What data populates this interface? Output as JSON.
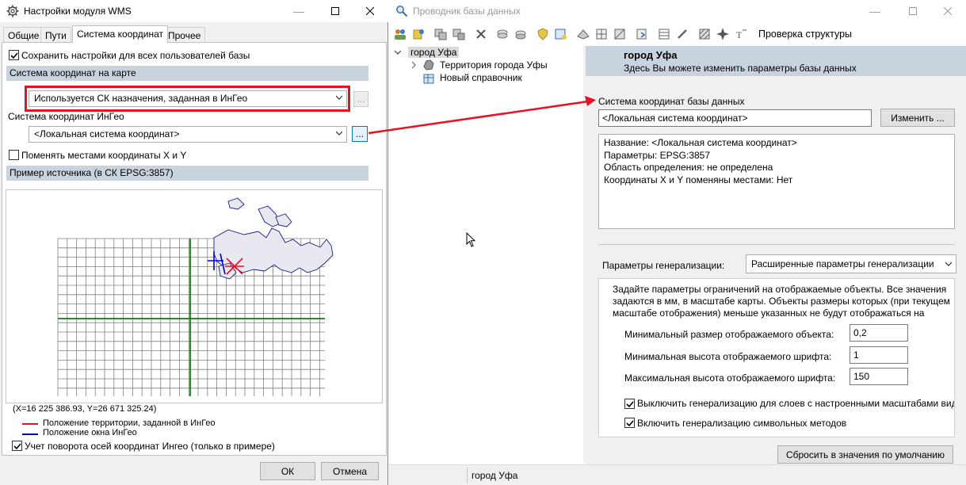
{
  "wms_dialog": {
    "title": "Настройки модуля WMS",
    "tabs": [
      "Общие",
      "Пути",
      "Система координат",
      "Прочее"
    ],
    "save_for_all_label": "Сохранить настройки для всех пользователей базы",
    "save_for_all_checked": true,
    "map_cs_header": "Система координат на карте",
    "map_cs_value": "Используется СК назначения, заданная в ИнГео",
    "dots_label": "...",
    "ingeo_cs_label": "Система координат ИнГео",
    "ingeo_cs_value": "<Локальная система координат>",
    "swap_xy_label": "Поменять местами координаты X и Y",
    "swap_xy_checked": false,
    "sample_header": "Пример источника (в СК EPSG:3857)",
    "coords_readout": "(X=16 225 386.93, Y=26 671 325.24)",
    "legend_red": "Положение территории, заданной в ИнГео",
    "legend_blue": "Положение окна ИнГео",
    "rotation_label": "Учет поворота осей координат Ингео (только в примере)",
    "rotation_checked": true,
    "ok_label": "ОК",
    "cancel_label": "Отмена",
    "colors": {
      "red": "#e81123",
      "blue": "#0000c8",
      "green": "#107c10",
      "highlight": "#e81123"
    }
  },
  "explorer": {
    "title": "Проводник базы данных",
    "toolbar_text_button": "Проверка структуры",
    "tree": {
      "root": "город Уфа",
      "children": [
        "Территория города Уфы",
        "Новый справочник"
      ]
    },
    "header_title": "город Уфа",
    "header_subtitle": "Здесь Вы можете изменить параметры базы данных",
    "db_cs_label": "Система координат базы данных",
    "db_cs_value": "<Локальная система координат>",
    "change_button": "Изменить ...",
    "cs_info": [
      "Название: <Локальная система координат>",
      "Параметры: EPSG:3857",
      "Область определения: не определена",
      "Координаты X и Y поменяны местами: Нет"
    ],
    "gen_params_label": "Параметры генерализации:",
    "gen_params_value": "Расширенные параметры генерализации",
    "gen_description": [
      "Задайте параметры ограничений на отображаемые объекты. Все значения",
      "задаются в мм, в масштабе карты. Объекты размеры которых (при текущем",
      "масштабе отображения) меньше указанных не будут отображаться на"
    ],
    "min_object_label": "Минимальный размер отображаемого объекта:",
    "min_object_value": "0,2",
    "min_font_label": "Минимальная высота отображаемого шрифта:",
    "min_font_value": "1",
    "max_font_label": "Максимальная высота отображаемого шрифта:",
    "max_font_value": "150",
    "disable_gen_scaled_label": "Выключить генерализацию для слоев с настроенными масштабами вид",
    "disable_gen_scaled_checked": true,
    "enable_gen_symbol_label": "Включить генерализацию символьных методов",
    "enable_gen_symbol_checked": true,
    "reset_button": "Сбросить в значения по умолчанию",
    "status_text": "город Уфа"
  }
}
